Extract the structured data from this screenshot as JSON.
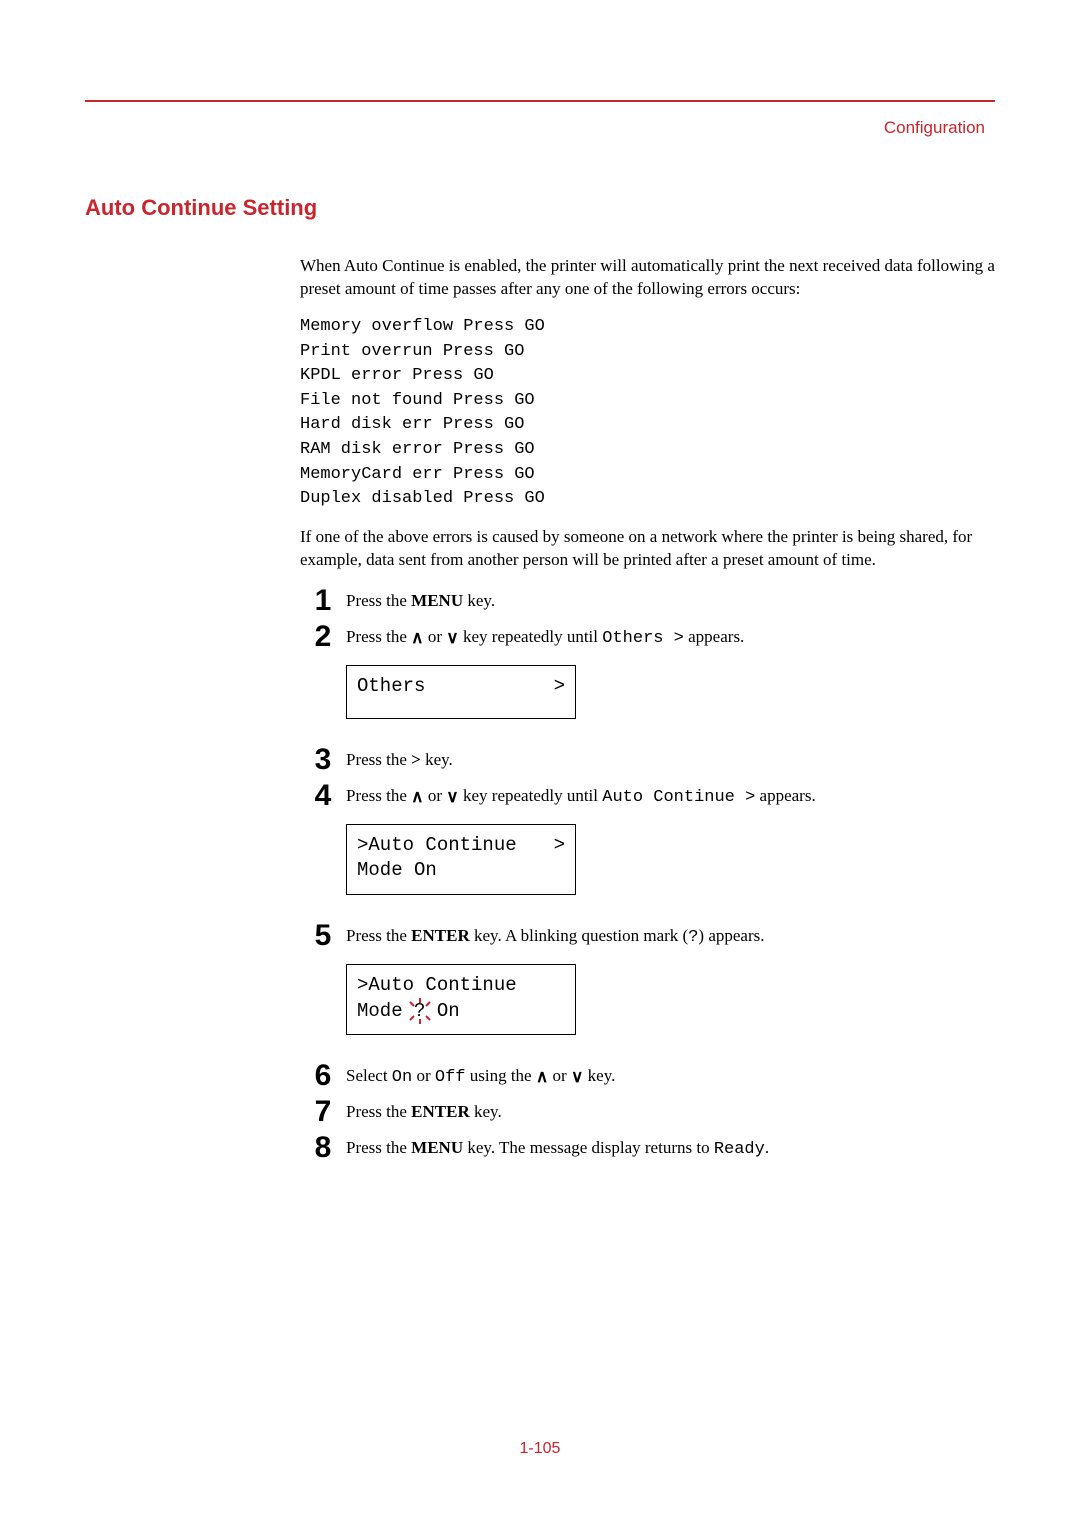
{
  "header": {
    "running_title": "Configuration"
  },
  "section": {
    "heading": "Auto Continue Setting",
    "intro": "When Auto Continue is enabled, the printer will automatically print the next received data following a preset amount of time passes after any one of the following errors occurs:",
    "errors": "Memory overflow Press GO\nPrint overrun Press GO\nKPDL error Press GO\nFile not found Press GO\nHard disk err Press GO\nRAM disk error Press GO\nMemoryCard err Press GO\nDuplex disabled Press GO",
    "note": "If one of the above errors is caused by someone on a network where the printer is being shared, for example, data sent from another person will be printed after a preset amount of time."
  },
  "steps": {
    "s1": {
      "num": "1",
      "pre": "Press the ",
      "key": "MENU",
      "post": " key."
    },
    "s2": {
      "num": "2",
      "pre": "Press the ",
      "mid": " or ",
      "mid2": " key repeatedly until ",
      "code": "Others >",
      "post": " appears.",
      "display_left": "Others",
      "display_right": ">"
    },
    "s3": {
      "num": "3",
      "pre": "Press the ",
      "key": ">",
      "post": " key."
    },
    "s4": {
      "num": "4",
      "pre": "Press the ",
      "mid": " or ",
      "mid2": " key repeatedly until ",
      "code": "Auto Continue >",
      "post": " appears.",
      "display_l1_left": ">Auto Continue",
      "display_l1_right": ">",
      "display_l2": " Mode   On"
    },
    "s5": {
      "num": "5",
      "pre": "Press the ",
      "key": "ENTER",
      "mid": " key. A blinking question mark (",
      "code": "?",
      "post": ") appears.",
      "display_l1": ">Auto Continue",
      "display_l2_pre": " Mode ",
      "display_l2_q": "?",
      "display_l2_post": " On"
    },
    "s6": {
      "num": "6",
      "pre": "Select ",
      "code1": "On",
      "mid1": " or ",
      "code2": "Off",
      "mid2": " using the ",
      "mid3": " or ",
      "post": " key."
    },
    "s7": {
      "num": "7",
      "pre": "Press the ",
      "key": "ENTER",
      "post": " key."
    },
    "s8": {
      "num": "8",
      "pre": "Press the ",
      "key": "MENU",
      "mid": " key. The message display returns to ",
      "code": "Ready",
      "post": "."
    }
  },
  "footer": {
    "page_number": "1-105"
  },
  "glyphs": {
    "up": "∧",
    "down": "∨"
  }
}
